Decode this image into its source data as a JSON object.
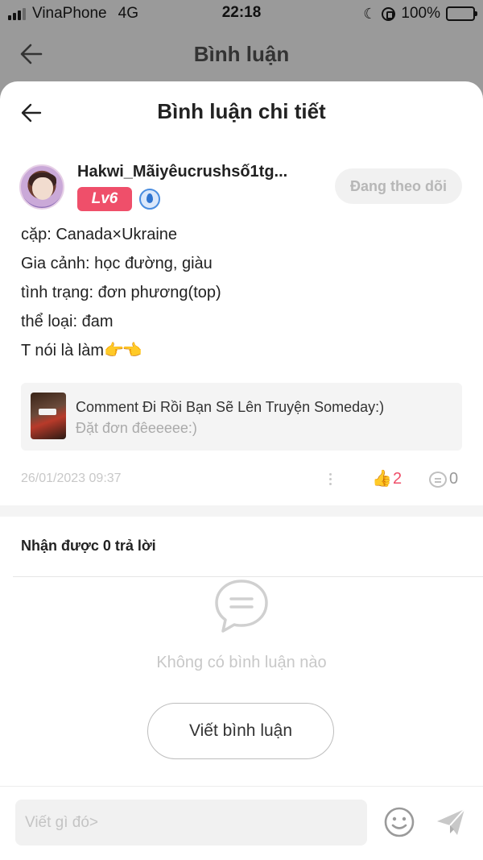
{
  "status_bar": {
    "carrier": "VinaPhone",
    "network": "4G",
    "time": "22:18",
    "battery": "100%"
  },
  "header": {
    "title": "Bình luận",
    "back_icon": "back-arrow-icon"
  },
  "sheet": {
    "title": "Bình luận chi tiết",
    "back_icon": "back-arrow-icon"
  },
  "comment": {
    "username": "Hakwi_Mãiyêucrushsố1tg...",
    "level": "Lv6",
    "follow_label": "Đang theo dõi",
    "lines": [
      "cặp: Canada×Ukraine",
      "Gia cảnh: học đường, giàu",
      "tình trạng: đơn phương(top)",
      "thể loại: đam",
      "T nói là làm"
    ],
    "emoji": "👉👈",
    "quote": {
      "title": "Comment Đi Rồi Bạn Sẽ Lên Truyện Someday:)",
      "subtitle": "Đặt đơn đêeeeee:)"
    },
    "date": "26/01/2023 09:37",
    "likes": "2",
    "replies": "0"
  },
  "replies_section": {
    "heading": "Nhận được 0 trả lời",
    "empty_text": "Không có bình luận nào",
    "write_button": "Viết bình luận"
  },
  "input": {
    "placeholder": "Viết gì đó>"
  },
  "colors": {
    "accent": "#ef4f6a",
    "battery": "#f5c21b",
    "badge_blue": "#2f74d0"
  }
}
